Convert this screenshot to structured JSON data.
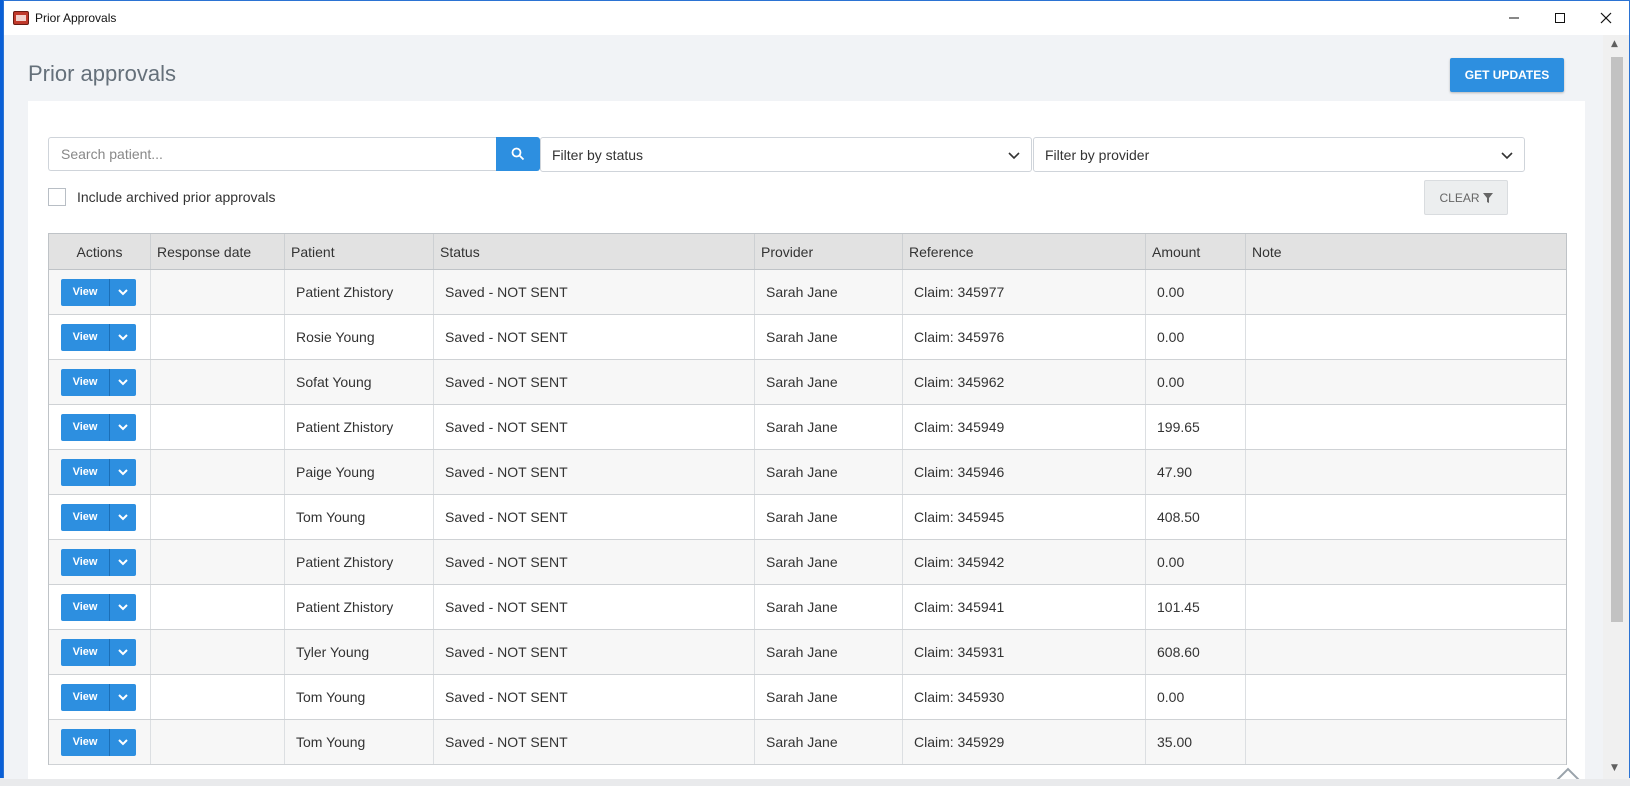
{
  "window": {
    "title": "Prior Approvals"
  },
  "page": {
    "title": "Prior approvals",
    "get_updates_label": "GET UPDATES"
  },
  "filters": {
    "search_placeholder": "Search patient...",
    "status_select": "Filter by status",
    "provider_select": "Filter by provider",
    "archived_label": "Include archived prior approvals",
    "clear_label": "CLEAR"
  },
  "table": {
    "headers": [
      "Actions",
      "Response date",
      "Patient",
      "Status",
      "Provider",
      "Reference",
      "Amount",
      "Note"
    ],
    "view_label": "View",
    "rows": [
      {
        "response_date": "",
        "patient": "Patient Zhistory",
        "status": "Saved - NOT SENT",
        "provider": "Sarah Jane",
        "reference": "Claim: 345977",
        "amount": "0.00",
        "note": ""
      },
      {
        "response_date": "",
        "patient": "Rosie Young",
        "status": "Saved - NOT SENT",
        "provider": "Sarah Jane",
        "reference": "Claim: 345976",
        "amount": "0.00",
        "note": ""
      },
      {
        "response_date": "",
        "patient": "Sofat Young",
        "status": "Saved - NOT SENT",
        "provider": "Sarah Jane",
        "reference": "Claim: 345962",
        "amount": "0.00",
        "note": ""
      },
      {
        "response_date": "",
        "patient": "Patient Zhistory",
        "status": "Saved - NOT SENT",
        "provider": "Sarah Jane",
        "reference": "Claim: 345949",
        "amount": "199.65",
        "note": ""
      },
      {
        "response_date": "",
        "patient": "Paige Young",
        "status": "Saved - NOT SENT",
        "provider": "Sarah Jane",
        "reference": "Claim: 345946",
        "amount": "47.90",
        "note": ""
      },
      {
        "response_date": "",
        "patient": "Tom Young",
        "status": "Saved - NOT SENT",
        "provider": "Sarah Jane",
        "reference": "Claim: 345945",
        "amount": "408.50",
        "note": ""
      },
      {
        "response_date": "",
        "patient": "Patient Zhistory",
        "status": "Saved - NOT SENT",
        "provider": "Sarah Jane",
        "reference": "Claim: 345942",
        "amount": "0.00",
        "note": ""
      },
      {
        "response_date": "",
        "patient": "Patient Zhistory",
        "status": "Saved - NOT SENT",
        "provider": "Sarah Jane",
        "reference": "Claim: 345941",
        "amount": "101.45",
        "note": ""
      },
      {
        "response_date": "",
        "patient": "Tyler Young",
        "status": "Saved - NOT SENT",
        "provider": "Sarah Jane",
        "reference": "Claim: 345931",
        "amount": "608.60",
        "note": ""
      },
      {
        "response_date": "",
        "patient": "Tom Young",
        "status": "Saved - NOT SENT",
        "provider": "Sarah Jane",
        "reference": "Claim: 345930",
        "amount": "0.00",
        "note": ""
      },
      {
        "response_date": "",
        "patient": "Tom Young",
        "status": "Saved - NOT SENT",
        "provider": "Sarah Jane",
        "reference": "Claim: 345929",
        "amount": "35.00",
        "note": ""
      }
    ]
  },
  "colors": {
    "accent": "#2d8fe0",
    "header_bg": "#e2e2e2",
    "page_bg": "#f1f3f6"
  },
  "icons": [
    "app-icon",
    "minimize-icon",
    "maximize-icon",
    "close-icon",
    "search-icon",
    "chevron-down-icon",
    "filter-icon",
    "scroll-to-top-icon"
  ]
}
